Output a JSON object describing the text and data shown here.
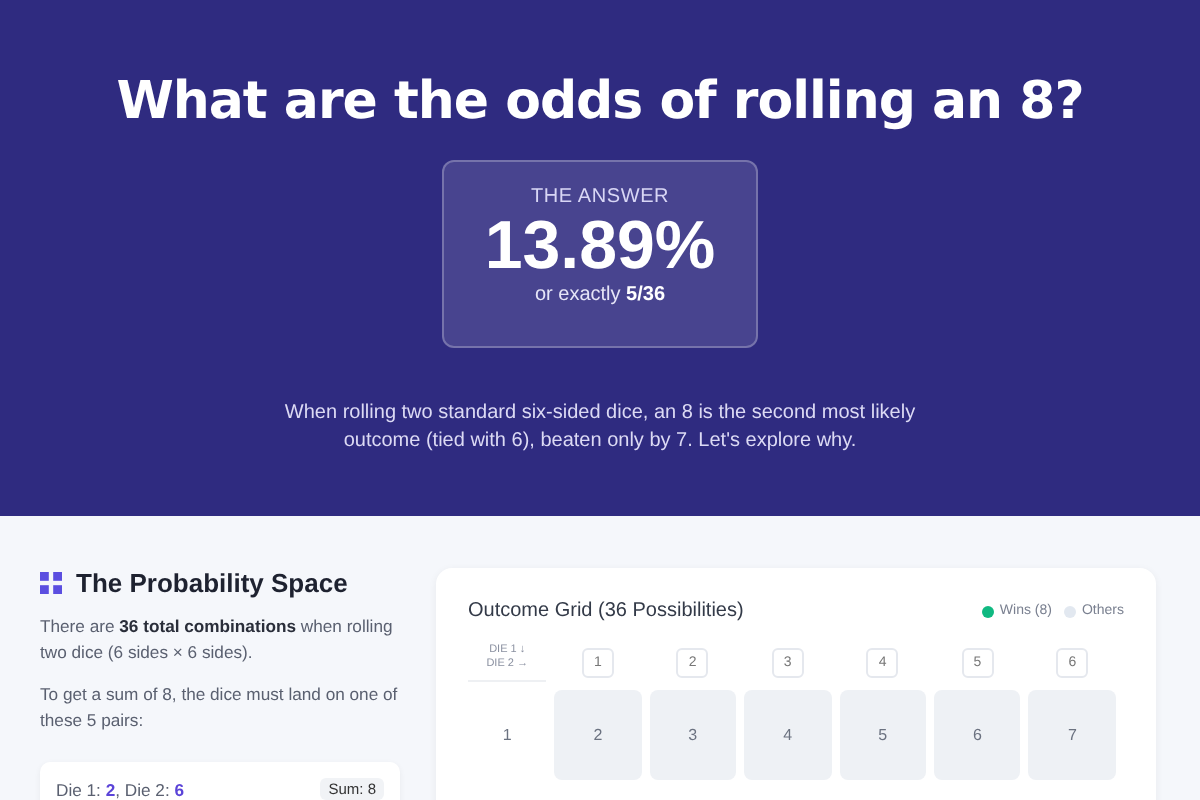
{
  "hero": {
    "title": "What are the odds of rolling an 8?",
    "answer_label": "THE ANSWER",
    "answer_value": "13.89%",
    "answer_fraction": "or exactly **5/36**",
    "description": "When rolling two standard six-sided dice, an 8 is the second most likely outcome (tied with 6), beaten only by 7. Let's explore why."
  },
  "probability_space": {
    "title": "The Probability Space",
    "paragraphs": [
      "There are **36 total combinations** when rolling two dice (6 sides × 6 sides).",
      "To get a sum of 8, the dice must land on one of these 5 pairs:"
    ],
    "pairs": [
      {
        "text": "Die 1: **2**, Die 2: **6**",
        "sum": "Sum: 8"
      }
    ]
  },
  "outcome_grid": {
    "title": "Outcome Grid (36 Possibilities)",
    "legend": [
      {
        "label": "Wins (8)",
        "color": "#10b981"
      },
      {
        "label": "Others",
        "color": "#e2e8f0"
      }
    ],
    "axis_label": [
      "DIE 1 ↓",
      "DIE 2 →"
    ],
    "column_headers": [
      "1",
      "2",
      "3",
      "4",
      "5",
      "6"
    ],
    "rows": [
      {
        "header": "1",
        "cells": [
          {
            "value": "2",
            "win": false
          },
          {
            "value": "3",
            "win": false
          },
          {
            "value": "4",
            "win": false
          },
          {
            "value": "5",
            "win": false
          },
          {
            "value": "6",
            "win": false
          },
          {
            "value": "7",
            "win": false
          }
        ]
      }
    ]
  }
}
